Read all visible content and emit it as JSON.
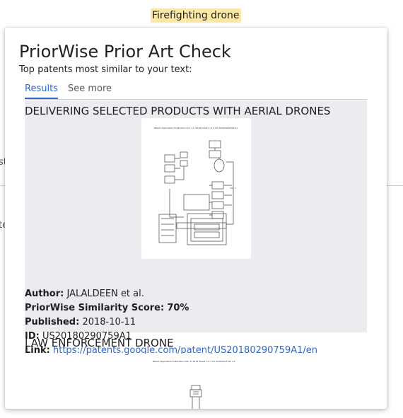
{
  "background": {
    "highlight_text": "Firefighting drone",
    "fragment_1": "st",
    "fragment_2": "te"
  },
  "popup": {
    "title": "PriorWise Prior Art Check",
    "subtitle": "Top patents most similar to your text:",
    "tabs": [
      {
        "label": "Results",
        "active": true
      },
      {
        "label": "See more",
        "active": false
      }
    ],
    "labels": {
      "author": "Author:",
      "score": "PriorWise Similarity Score:",
      "published": "Published:",
      "id": "ID:",
      "link": "Link:"
    },
    "results": [
      {
        "title": "DELIVERING SELECTED PRODUCTS WITH AERIAL DRONES",
        "image_header": "Patent Application Publication   Oct. 11, 2018  Sheet 1 of 4   US 2018/0290759 A1",
        "author": "JALALDEEN et al.",
        "score": "70%",
        "published": "2018-10-11",
        "id": "US20180290759A1",
        "link": "https://patents.google.com/patent/US20180290759A1/en"
      },
      {
        "title": "LAW ENFORCEMENT DRONE",
        "image_header": "Patent Application Publication   Feb. 8, 2018  Sheet 1 of 2   US 2018/0037321 A1"
      }
    ]
  },
  "colors": {
    "accent": "#3366cc",
    "result_bg": "#eaecf0",
    "highlight": "#fce8a4"
  }
}
